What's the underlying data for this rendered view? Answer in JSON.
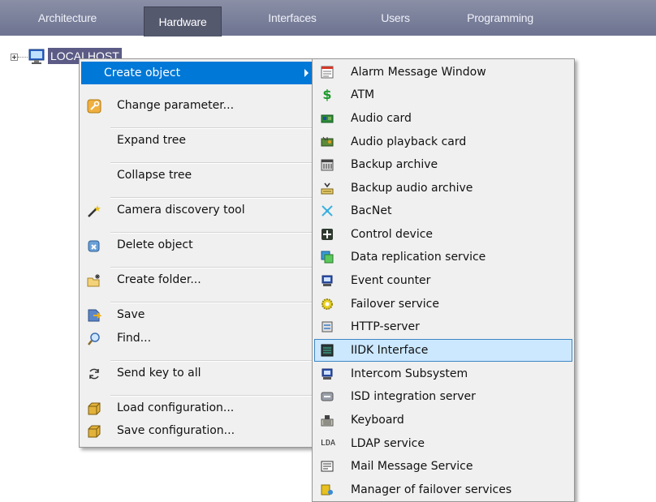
{
  "tabs": [
    "Architecture",
    "Hardware",
    "Interfaces",
    "Users",
    "Programming"
  ],
  "active_tab": "Hardware",
  "tree": {
    "root_label": "LOCALHOST"
  },
  "context_menu": {
    "items": [
      "Create object",
      "Change parameter...",
      "Expand tree",
      "Collapse tree",
      "Camera discovery tool",
      "Delete object",
      "Create folder...",
      "Save",
      "Find...",
      "Send key to all",
      "Load configuration...",
      "Save configuration..."
    ]
  },
  "submenu": {
    "items": [
      "Alarm Message Window",
      "ATM",
      "Audio card",
      "Audio playback card",
      "Backup archive",
      "Backup audio archive",
      "BacNet",
      "Control device",
      "Data replication service",
      "Event counter",
      "Failover service",
      "HTTP-server",
      "IIDK Interface",
      "Intercom Subsystem",
      "ISD integration server",
      "Keyboard",
      "LDAP service",
      "Mail Message Service",
      "Manager of failover services"
    ],
    "hovered": "IIDK Interface"
  },
  "colors": {
    "tabbar": "#6d7390",
    "tab_active": "#55596e",
    "menu_highlight": "#0078d7",
    "submenu_hover": "#cce8ff"
  }
}
